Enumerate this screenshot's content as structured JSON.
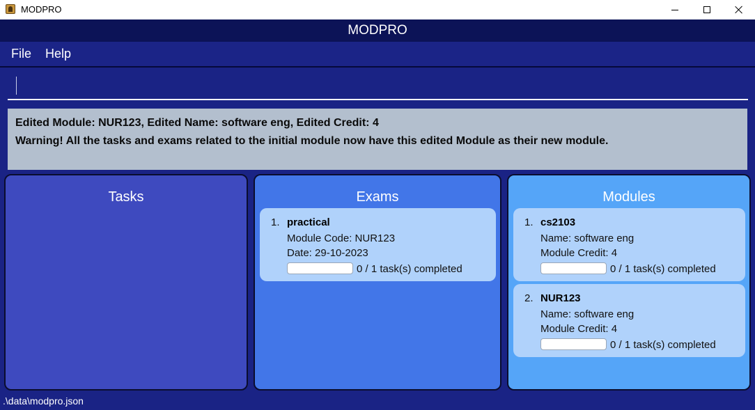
{
  "window": {
    "title": "MODPRO",
    "app_icon": "application-icon",
    "controls": [
      "minimize-icon",
      "maximize-icon",
      "close-icon"
    ]
  },
  "header": {
    "title": "MODPRO"
  },
  "menu": {
    "file": "File",
    "help": "Help"
  },
  "command": {
    "value": "",
    "placeholder": ""
  },
  "result": {
    "line1": "Edited Module: NUR123, Edited Name: software eng, Edited Credit: 4",
    "line2": "Warning! All the tasks and exams related to the initial module now have this edited Module as their new module."
  },
  "tasks": {
    "title": "Tasks",
    "items": []
  },
  "exams": {
    "title": "Exams",
    "items": [
      {
        "index": "1.",
        "name": "practical",
        "line1": "Module Code: NUR123",
        "line2": "Date: 29-10-2023",
        "progress": 0,
        "progress_text": "0 / 1 task(s) completed"
      }
    ]
  },
  "modules": {
    "title": "Modules",
    "items": [
      {
        "index": "1.",
        "name": "cs2103",
        "line1": "Name: software eng",
        "line2": "Module Credit: 4",
        "progress": 0,
        "progress_text": "0 / 1 task(s) completed"
      },
      {
        "index": "2.",
        "name": "NUR123",
        "line1": "Name: software eng",
        "line2": "Module Credit: 4",
        "progress": 0,
        "progress_text": "0 / 1 task(s) completed"
      }
    ]
  },
  "status": {
    "path": ".\\data\\modpro.json"
  },
  "colors": {
    "background": "#1a2385",
    "header": "#0c1357",
    "tasks_panel": "#3e4abf",
    "exams_panel": "#4276e8",
    "modules_panel": "#55a5f8",
    "card": "#b0d2fb",
    "result_box": "#b3bfce"
  }
}
